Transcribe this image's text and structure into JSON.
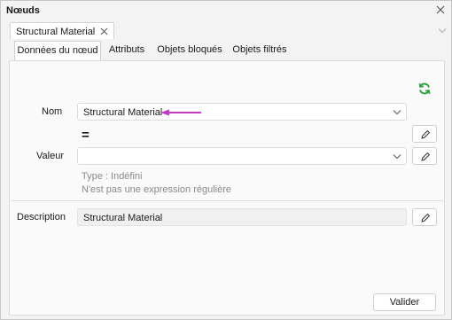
{
  "window": {
    "title": "Nœuds"
  },
  "doc_tab": {
    "label": "Structural Material"
  },
  "tabs": [
    {
      "label": "Données du nœud",
      "active": true
    },
    {
      "label": "Attributs",
      "active": false
    },
    {
      "label": "Objets bloqués",
      "active": false
    },
    {
      "label": "Objets filtrés",
      "active": false
    }
  ],
  "form": {
    "name_label": "Nom",
    "name_value": "Structural Material",
    "equals_symbol": "=",
    "value_label": "Valeur",
    "value_value": "",
    "type_hint": "Type : Indéfini",
    "regex_hint": "N'est pas une expression régulière",
    "description_label": "Description",
    "description_value": "Structural Material"
  },
  "buttons": {
    "validate_label": "Valider"
  },
  "icons": {
    "close": "close-icon",
    "refresh": "refresh-icon",
    "edit": "pencil-icon",
    "dropdown": "chevron-down-icon",
    "annotation": "arrow-left-icon"
  },
  "colors": {
    "refresh_green": "#2e9e3e",
    "annotation_arrow": "#c23ac4",
    "hint_text": "#8a8a8a"
  }
}
